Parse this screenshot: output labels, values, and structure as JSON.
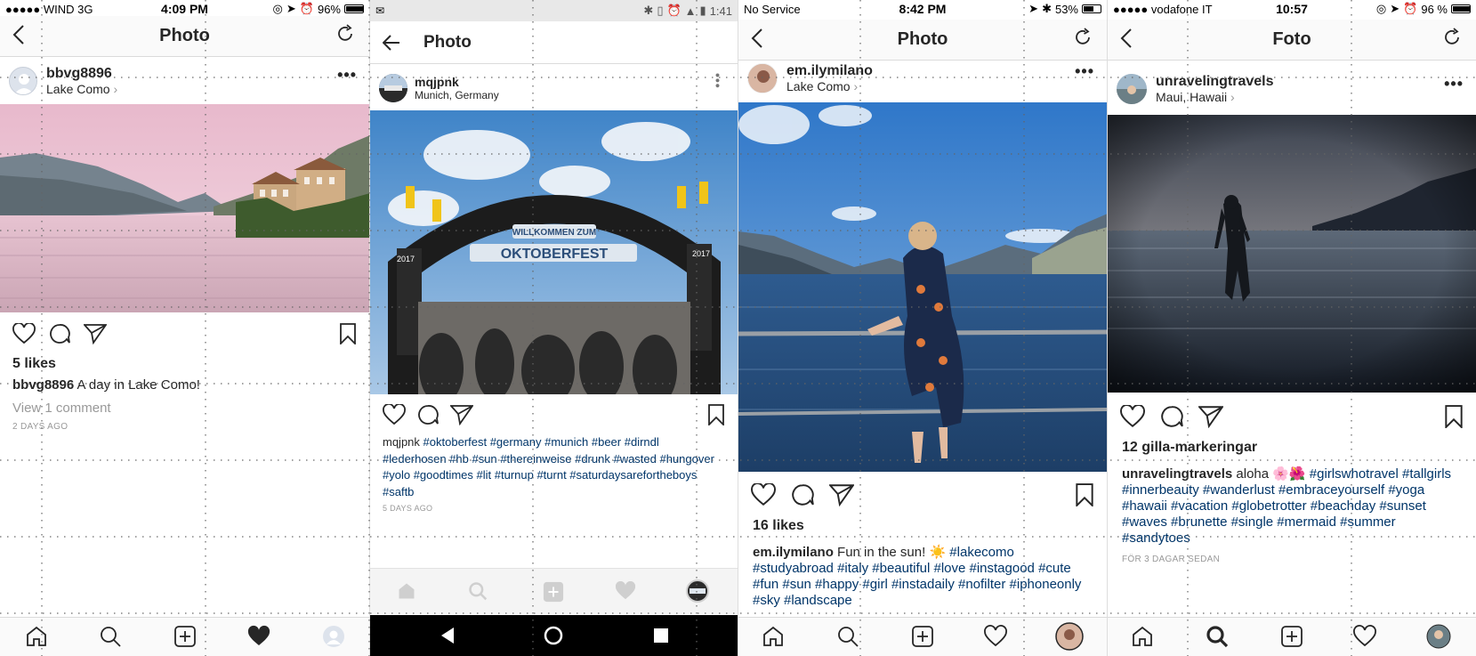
{
  "panels": [
    {
      "status": {
        "left": "●●●●● WIND  3G",
        "time": "4:09 PM",
        "battery": "96%"
      },
      "nav": {
        "title": "Photo"
      },
      "post": {
        "user": "bbvg8896",
        "location": "Lake Como"
      },
      "likes": "5 likes",
      "caption": {
        "user": "bbvg8896",
        "text": "A day in Lake Como!"
      },
      "comments": "View 1 comment",
      "timestamp": "2 DAYS AGO"
    },
    {
      "status": {
        "time": "1:41"
      },
      "nav": {
        "title": "Photo"
      },
      "post": {
        "user": "mqjpnk",
        "location": "Munich, Germany"
      },
      "photo_text": {
        "banner1": "WILLKOMMEN ZUM",
        "banner2": "OKTOBERFEST",
        "year": "2017"
      },
      "caption": {
        "user": "mqjpnk",
        "text": "#oktoberfest #germany #munich #beer #dirndl #lederhosen #hb #sun #thereinweise #drunk #wasted #hungover #yolo #goodtimes #lit #turnup #turnt #saturdaysarefortheboys #saftb"
      },
      "timestamp": "5 DAYS AGO"
    },
    {
      "status": {
        "left": "No Service",
        "time": "8:42 PM",
        "battery": "53%"
      },
      "nav": {
        "title": "Photo"
      },
      "post": {
        "user": "em.ilymilano",
        "location": "Lake Como"
      },
      "likes": "16 likes",
      "caption": {
        "user": "em.ilymilano",
        "text": "Fun in the sun! ☀️",
        "tags": "#lakecomo #studyabroad #italy #beautiful #love #instagood #cute #fun #sun #happy #girl #instadaily #nofilter #iphoneonly #sky #landscape"
      }
    },
    {
      "status": {
        "left": "●●●●● vodafone IT",
        "time": "10:57",
        "battery": "96 %"
      },
      "nav": {
        "title": "Foto"
      },
      "post": {
        "user": "unravelingtravels",
        "location": "Maui, Hawaii"
      },
      "likes": "12 gilla-markeringar",
      "caption": {
        "user": "unravelingtravels",
        "text": "aloha 🌸🌺",
        "tags": "#girlswhotravel #tallgirls #innerbeauty #wanderlust #embraceyourself #yoga #hawaii #vacation #globetrotter #beachday #sunset #waves #brunette #single #mermaid #summer #sandytoes"
      },
      "timestamp": "FÖR 3 DAGAR SEDAN"
    }
  ],
  "icons": {
    "back": "chevron-left",
    "back_android": "arrow-left",
    "refresh": "refresh",
    "more": "more-horizontal",
    "like": "heart",
    "comment": "speech-bubble",
    "share": "paper-plane",
    "save": "bookmark",
    "tabs": [
      "home",
      "search",
      "add",
      "activity",
      "profile"
    ]
  },
  "colors": {
    "hashtag": "#003569",
    "text": "#262626",
    "meta": "#999999",
    "bar": "#fafafa"
  }
}
